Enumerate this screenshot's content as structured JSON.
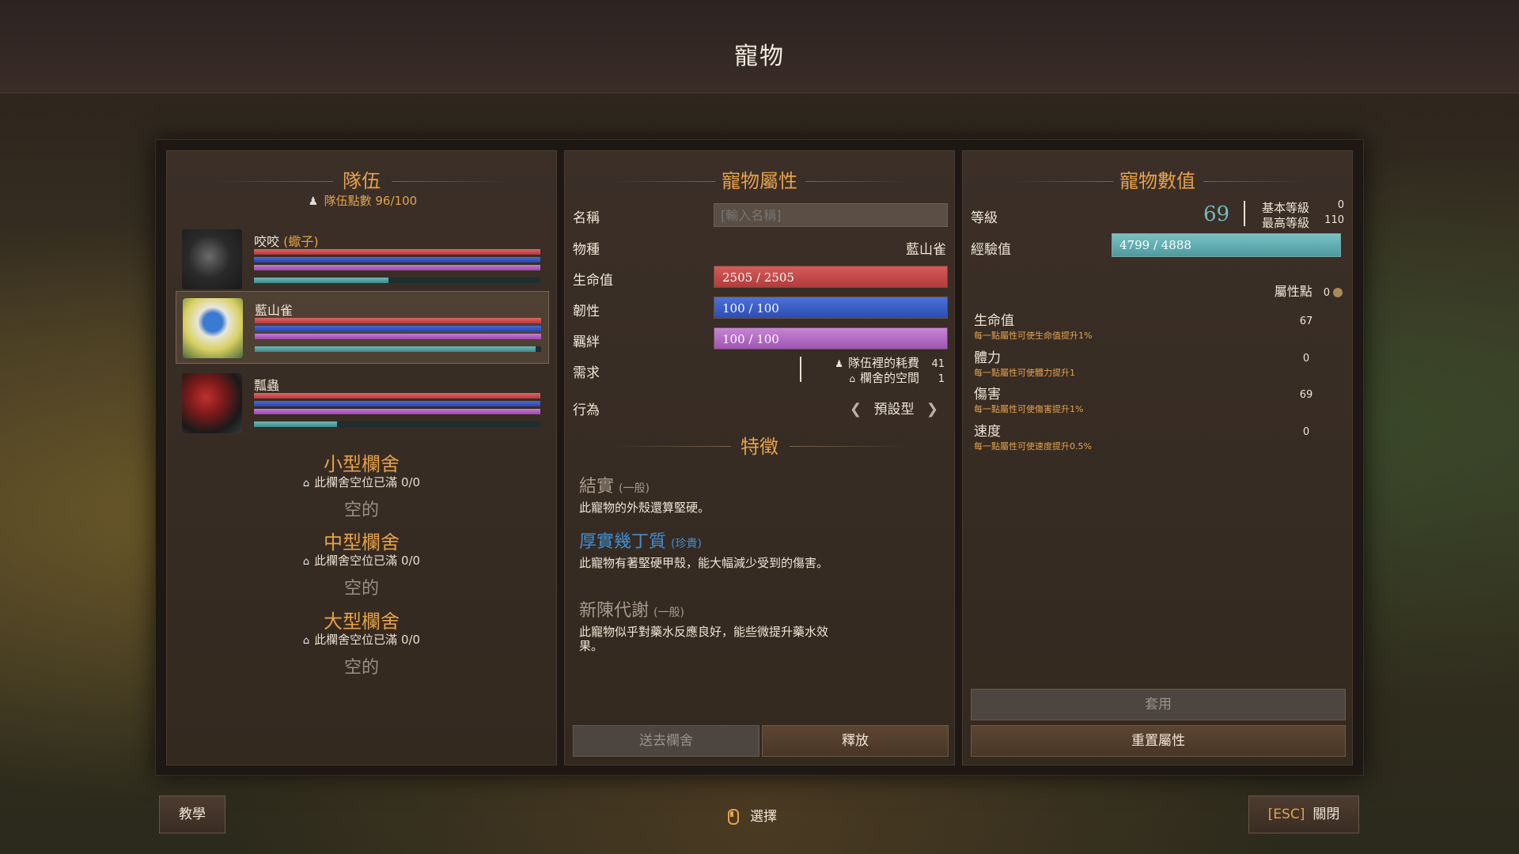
{
  "page_title": "寵物",
  "team": {
    "title": "隊伍",
    "points_label": "隊伍點數",
    "points_value": "96/100",
    "pets": [
      {
        "name": "咬咬",
        "tag": "(蠍子)",
        "hp": 1.0,
        "toughness": 1.0,
        "bond": 1.0,
        "xp": 0.47,
        "selected": false
      },
      {
        "name": "藍山雀",
        "tag": "",
        "hp": 1.0,
        "toughness": 1.0,
        "bond": 1.0,
        "xp": 0.98,
        "selected": true
      },
      {
        "name": "瓢蟲",
        "tag": "",
        "hp": 1.0,
        "toughness": 1.0,
        "bond": 1.0,
        "xp": 0.29,
        "selected": false
      }
    ]
  },
  "pens": [
    {
      "title": "小型欄舍",
      "status": "此欄舍空位已滿 0/0",
      "empty": "空的"
    },
    {
      "title": "中型欄舍",
      "status": "此欄舍空位已滿 0/0",
      "empty": "空的"
    },
    {
      "title": "大型欄舍",
      "status": "此欄舍空位已滿 0/0",
      "empty": "空的"
    }
  ],
  "attributes": {
    "title": "寵物屬性",
    "name_label": "名稱",
    "name_placeholder": "[輸入名稱]",
    "species_label": "物種",
    "species_value": "藍山雀",
    "hp_label": "生命值",
    "hp_value": "2505 / 2505",
    "toughness_label": "韌性",
    "toughness_value": "100 / 100",
    "bond_label": "羈絆",
    "bond_value": "100 / 100",
    "req_label": "需求",
    "req_team_label": "隊伍裡的耗費",
    "req_team_value": "41",
    "req_pen_label": "欄舍的空間",
    "req_pen_value": "1",
    "behavior_label": "行為",
    "behavior_value": "預設型",
    "traits_title": "特徵",
    "traits": [
      {
        "name": "結實",
        "rarity": "(一般)",
        "desc": "此寵物的外殼還算堅硬。",
        "color": "#a89a8a"
      },
      {
        "name": "厚實幾丁質",
        "rarity": "(珍貴)",
        "desc": "此寵物有著堅硬甲殼，能大幅減少受到的傷害。",
        "color": "#3f8fd6"
      },
      {
        "name": "新陳代謝",
        "rarity": "(一般)",
        "desc": "此寵物似乎對藥水反應良好，能些微提升藥水效果。",
        "color": "#a89a8a"
      }
    ],
    "send_to_pen": "送去欄舍",
    "release": "釋放"
  },
  "stats": {
    "title": "寵物數值",
    "level_label": "等級",
    "level_value": "69",
    "base_level_label": "基本等級",
    "base_level_value": "0",
    "max_level_label": "最高等級",
    "max_level_value": "110",
    "xp_label": "經驗值",
    "xp_value": "4799 / 4888",
    "xp_fraction": 0.98,
    "attr_points_label": "屬性點",
    "attr_points_value": "0",
    "items": [
      {
        "name": "生命值",
        "desc": "每一點屬性可使生命值提升1%",
        "value": "67"
      },
      {
        "name": "體力",
        "desc": "每一點屬性可使體力提升1",
        "value": "0"
      },
      {
        "name": "傷害",
        "desc": "每一點屬性可使傷害提升1%",
        "value": "69"
      },
      {
        "name": "速度",
        "desc": "每一點屬性可使速度提升0.5%",
        "value": "0"
      }
    ],
    "apply": "套用",
    "reset": "重置屬性"
  },
  "footer": {
    "tutorial": "教學",
    "select": "選擇",
    "esc_key": "[ESC]",
    "close": "關閉"
  }
}
